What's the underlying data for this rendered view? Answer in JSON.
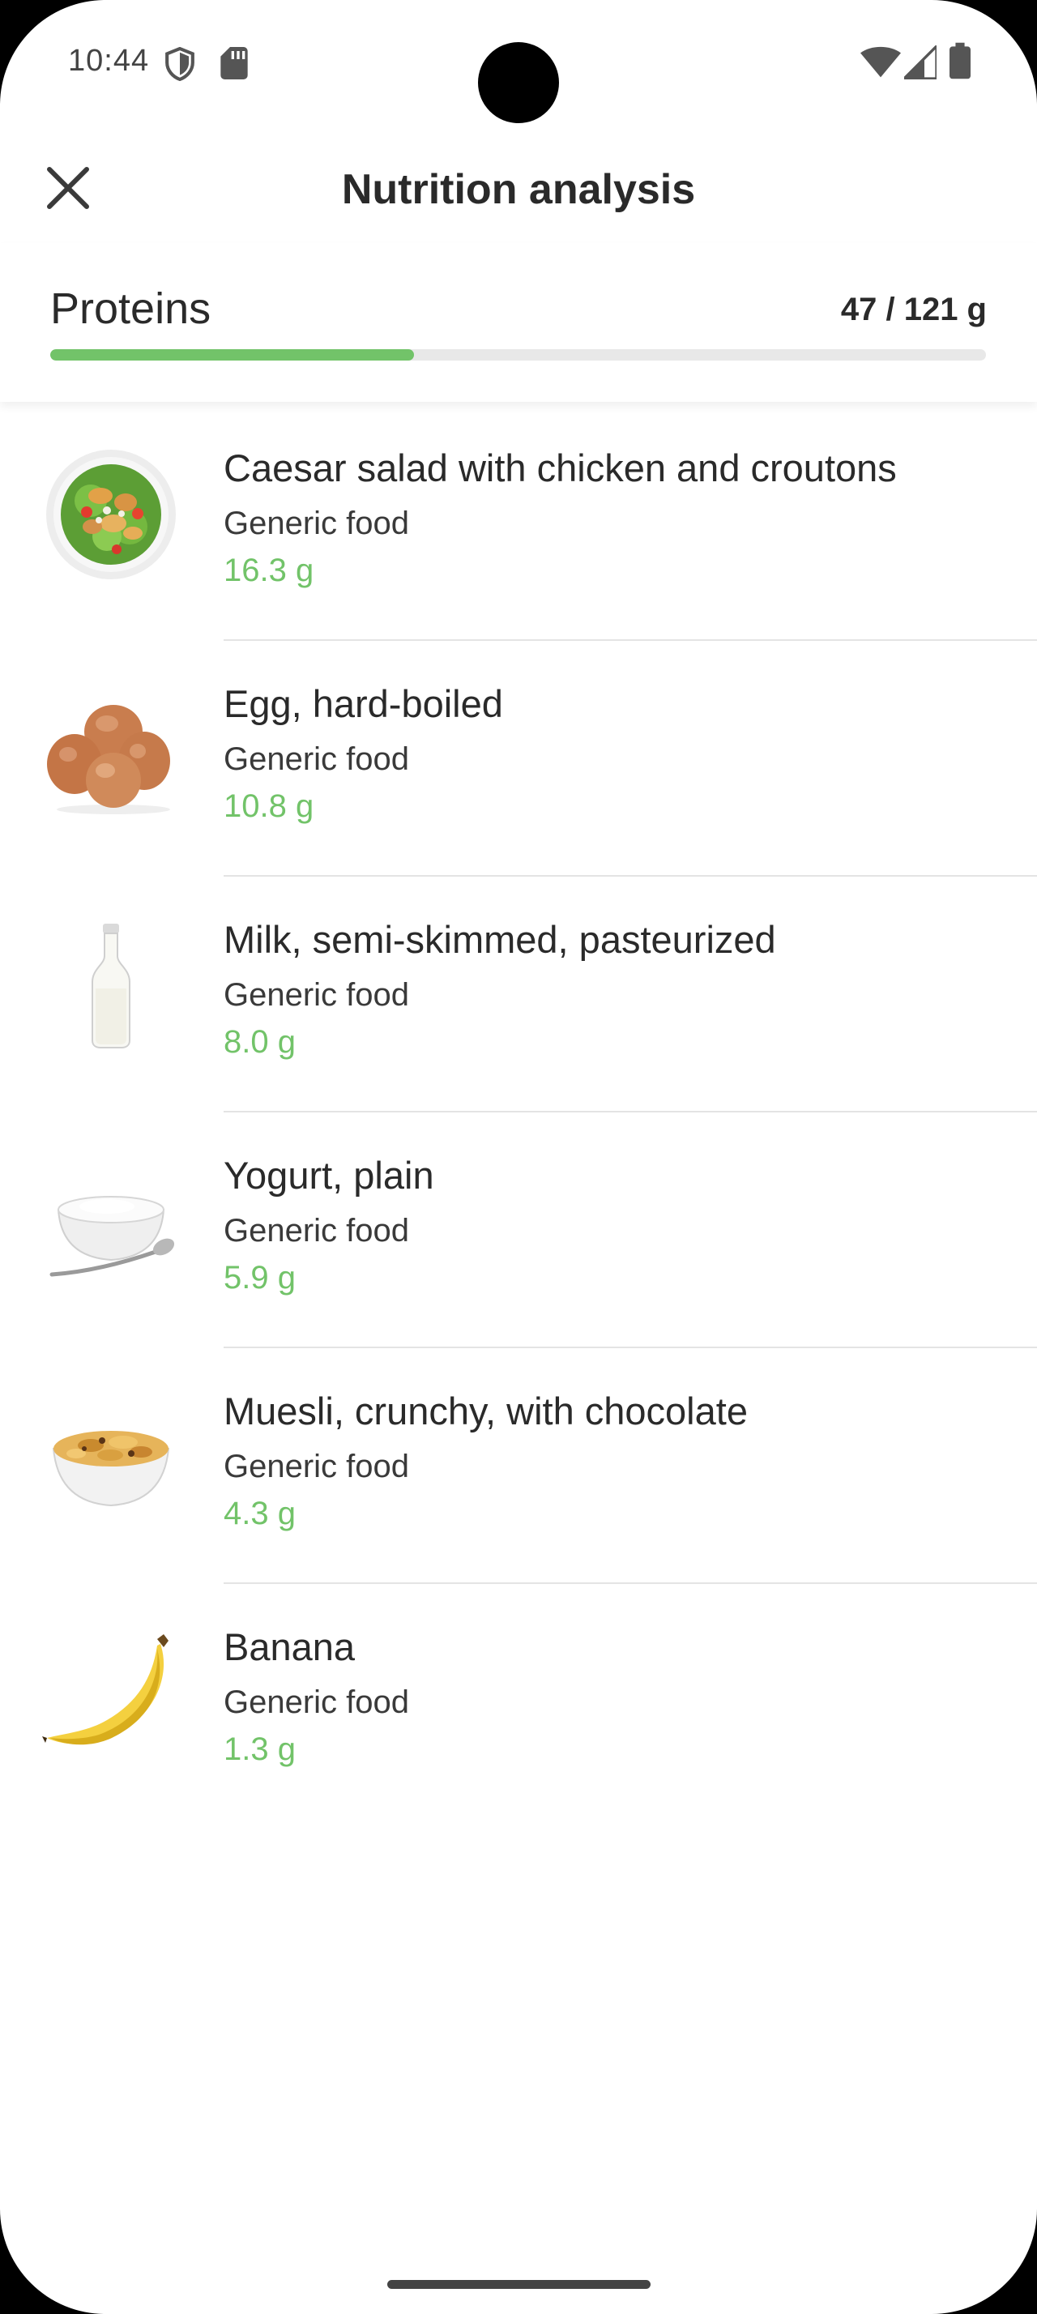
{
  "status": {
    "time": "10:44"
  },
  "header": {
    "title": "Nutrition analysis",
    "close_icon": "close-icon"
  },
  "summary": {
    "nutrient": "Proteins",
    "amount_text": "47 / 121 g",
    "progress_fraction": 0.3884,
    "accent_color": "#72C369"
  },
  "foods": [
    {
      "name": "Caesar salad with chicken and croutons",
      "source": "Generic food",
      "amount": "16.3 g",
      "icon": "caesar-salad-icon"
    },
    {
      "name": "Egg, hard-boiled",
      "source": "Generic food",
      "amount": "10.8 g",
      "icon": "eggs-icon"
    },
    {
      "name": "Milk, semi-skimmed, pasteurized",
      "source": "Generic food",
      "amount": "8.0 g",
      "icon": "milk-bottle-icon"
    },
    {
      "name": "Yogurt, plain",
      "source": "Generic food",
      "amount": "5.9 g",
      "icon": "yogurt-bowl-icon"
    },
    {
      "name": "Muesli, crunchy, with chocolate",
      "source": "Generic food",
      "amount": "4.3 g",
      "icon": "muesli-bowl-icon"
    },
    {
      "name": "Banana",
      "source": "Generic food",
      "amount": "1.3 g",
      "icon": "banana-icon"
    }
  ]
}
